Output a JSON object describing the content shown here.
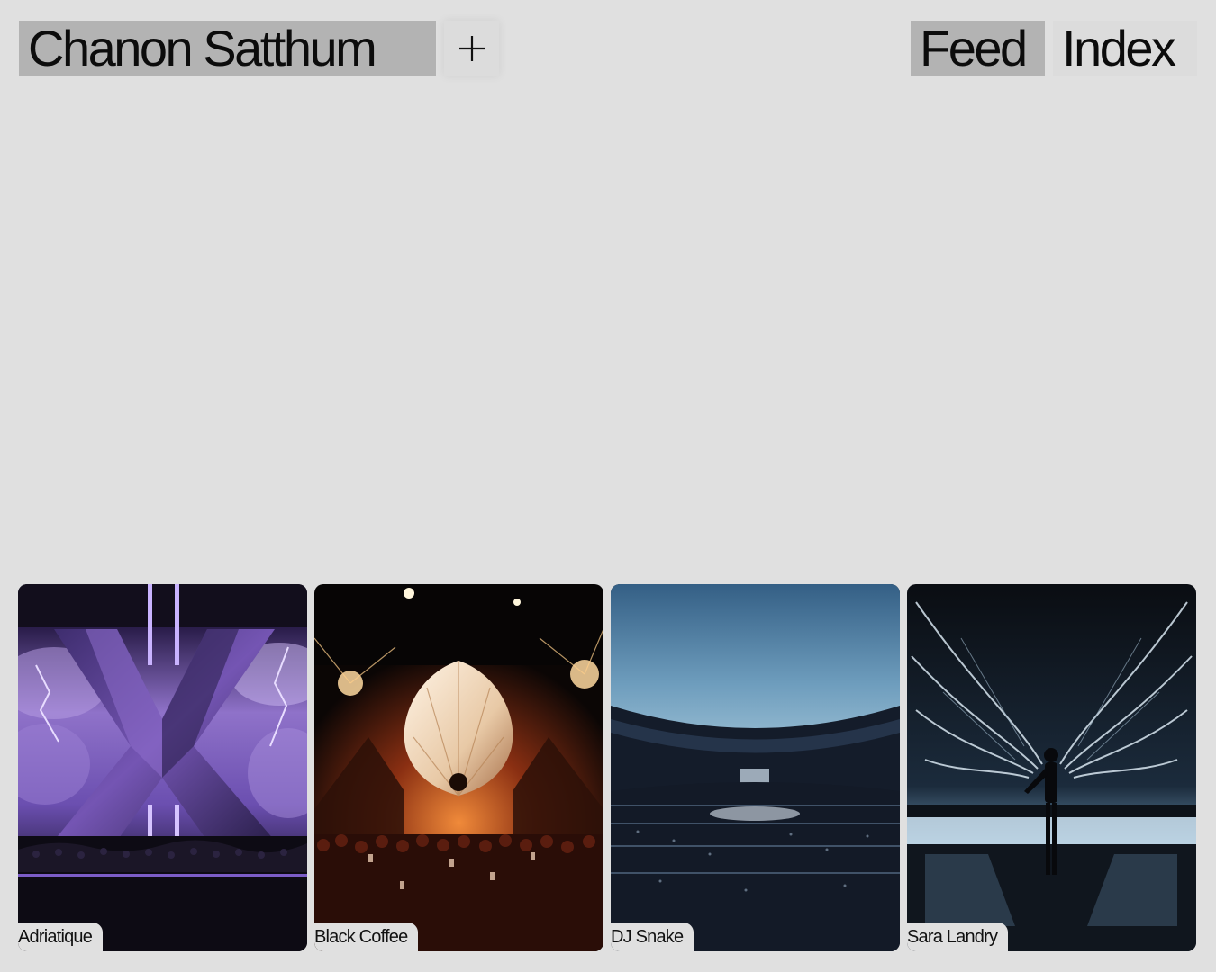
{
  "header": {
    "name": "Chanon Satthum",
    "plus_icon": "plus-icon",
    "nav": [
      {
        "label": "Feed",
        "active": true
      },
      {
        "label": "Index",
        "active": false
      }
    ]
  },
  "projects": [
    {
      "title": "Adriatique",
      "image": "purple X-shaped stage with lightning clouds over crowd"
    },
    {
      "title": "Black Coffee",
      "image": "orange-lit stage with large white sculpture above crowd"
    },
    {
      "title": "DJ Snake",
      "image": "stadium at dusk packed with crowd"
    },
    {
      "title": "Sara Landry",
      "image": "performer under giant wing-shaped light installation"
    }
  ],
  "colors": {
    "background": "#e0e0e0",
    "active_chip": "#b3b3b3",
    "inactive_chip": "#dcdcdc",
    "text": "#111111"
  }
}
